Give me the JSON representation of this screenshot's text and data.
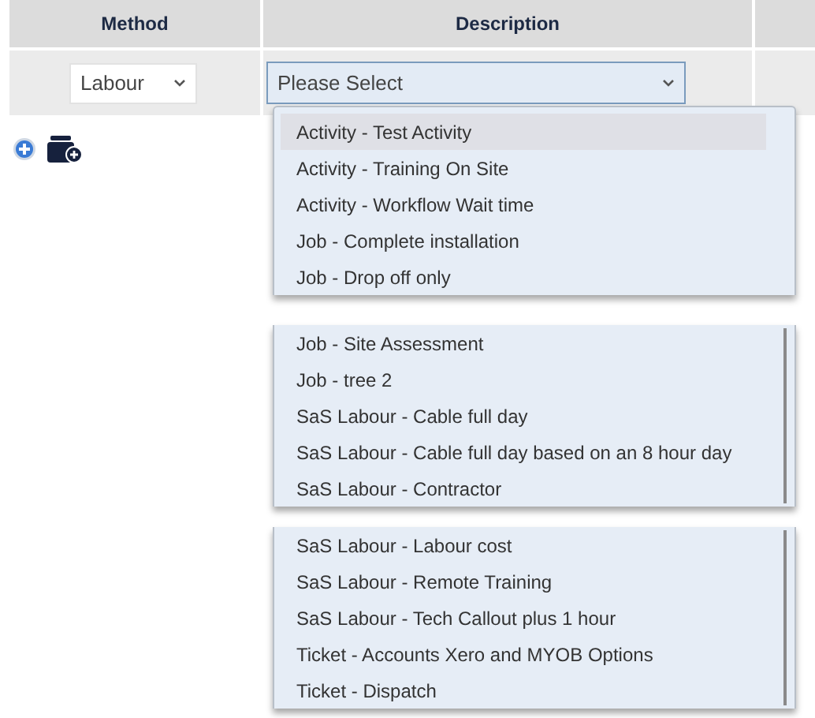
{
  "table": {
    "columns": [
      "Method",
      "Description"
    ],
    "row": {
      "method": "Labour",
      "description_placeholder": "Please Select"
    }
  },
  "dropdown": {
    "segments": [
      [
        {
          "label": "Activity - Test Activity",
          "selected": true
        },
        {
          "label": "Activity - Training On Site",
          "selected": false
        },
        {
          "label": "Activity - Workflow Wait time",
          "selected": false
        },
        {
          "label": "Job - Complete installation",
          "selected": false
        },
        {
          "label": "Job - Drop off only",
          "selected": false
        }
      ],
      [
        {
          "label": "Job - Site Assessment",
          "selected": false
        },
        {
          "label": "Job - tree 2",
          "selected": false
        },
        {
          "label": "SaS Labour - Cable full day",
          "selected": false
        },
        {
          "label": "SaS Labour - Cable full day based on an 8 hour day",
          "selected": false
        },
        {
          "label": "SaS Labour - Contractor",
          "selected": false
        }
      ],
      [
        {
          "label": "SaS Labour - Labour cost",
          "selected": false
        },
        {
          "label": "SaS Labour - Remote Training",
          "selected": false
        },
        {
          "label": "SaS Labour - Tech Callout plus 1 hour",
          "selected": false
        },
        {
          "label": "Ticket - Accounts Xero and MYOB Options",
          "selected": false
        },
        {
          "label": "Ticket - Dispatch",
          "selected": false
        }
      ]
    ]
  }
}
